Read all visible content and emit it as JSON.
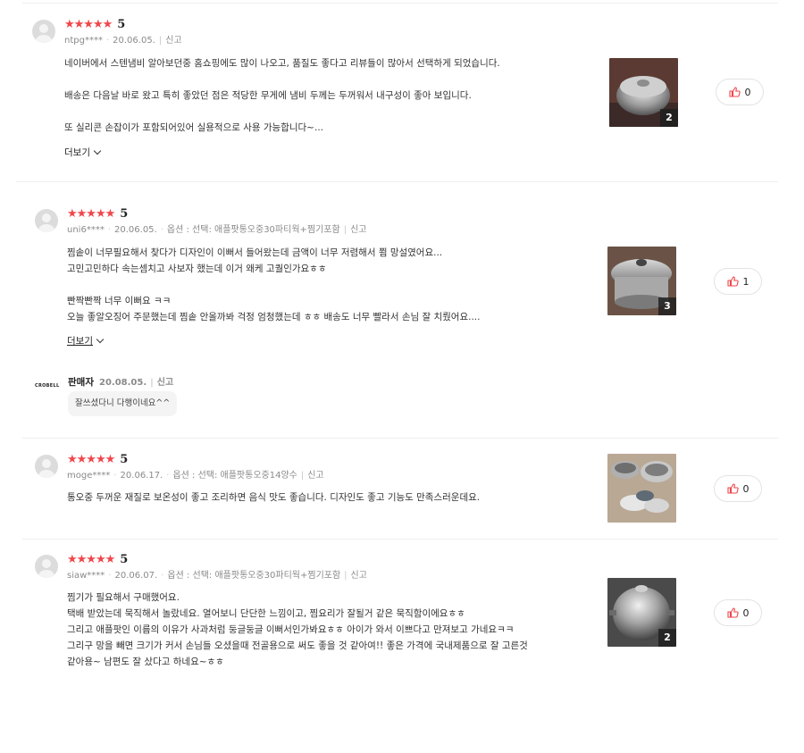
{
  "reviews": [
    {
      "rating_stars": "★★★★★",
      "rating": "5",
      "user": "ntpg****",
      "date": "20.06.05.",
      "report": "신고",
      "lines": [
        "네이버에서 스텐냄비 알아보던중 홈쇼핑에도 많이 나오고, 품질도 좋다고 리뷰들이 많아서 선택하게 되었습니다.",
        "",
        "배송은 다음날 바로 왔고 특히 좋았던 점은 적당한 무게에 냄비 두께는 두꺼워서 내구성이 좋아 보입니다.",
        "",
        "또 실리콘 손잡이가 포함되어있어 실용적으로 사용 가능합니다~..."
      ],
      "more": "더보기",
      "photo_count": "2",
      "likes": "0"
    },
    {
      "rating_stars": "★★★★★",
      "rating": "5",
      "user": "uni6****",
      "date": "20.06.05.",
      "option": "옵션 : 선택: 애플팟통오중30파티웍+찜기포함",
      "report": "신고",
      "lines": [
        "찜솥이 너무필요해서 찾다가 디자인이 이뻐서 들어왔는데 금액이 너무 저렴해서 쬠 망설였어요...",
        "고민고민하다 속는셈치고 사보자 했는데 이거 왜케 고퀄인가요ㅎㅎ",
        "",
        "빤짝빤짝 너무 이뻐요 ㅋㅋ",
        "오늘 좋알오징어 주문했는데 찜솥 안올까봐 걱정 엄청했는데 ㅎㅎ 배송도 너무 빨라서 손님 잘 치뤘어요...."
      ],
      "more": "더보기",
      "photo_count": "3",
      "likes": "1",
      "seller": {
        "logo": "CROBELL",
        "name": "판매자",
        "date": "20.08.05.",
        "report": "신고",
        "reply": "잘쓰셨다니 다행이네요^^"
      }
    },
    {
      "rating_stars": "★★★★★",
      "rating": "5",
      "user": "moge****",
      "date": "20.06.17.",
      "option": "옵션 : 선택: 애플팟통오중14양수",
      "report": "신고",
      "lines": [
        "통오중 두꺼운 재질로 보온성이 좋고 조리하면 음식 맛도 좋습니다. 디자인도 좋고 기능도 만족스러운데요."
      ],
      "likes": "0"
    },
    {
      "rating_stars": "★★★★★",
      "rating": "5",
      "user": "siaw****",
      "date": "20.06.07.",
      "option": "옵션 : 선택: 애플팟통오중30파티웍+찜기포함",
      "report": "신고",
      "lines": [
        "찜기가 필요해서 구매했어요.",
        "택배 받았는데 묵직해서 놀랐네요. 열어보니 단단한 느낌이고, 찜요리가 잘될거 같은 묵직함이에요ㅎㅎ",
        "그리고 애플팟인 이름의 이유가 사과처럼 둥글둥글 이뻐서인가봐요ㅎㅎ 아이가 와서 이쁘다고 만져보고 가네요ㅋㅋ",
        "그리구 망을 빼면 크기가 커서 손님들 오셨을때 전골용으로 써도 좋을 것 같아여!! 좋은 가격에 국내제품으로 잘 고른것",
        "같아용~ 남편도 잘 샀다고 하네요~ㅎㅎ"
      ],
      "photo_count": "2",
      "likes": "0"
    }
  ],
  "colors": {
    "star": "#f0464b",
    "like_icon": "#f0464b"
  }
}
